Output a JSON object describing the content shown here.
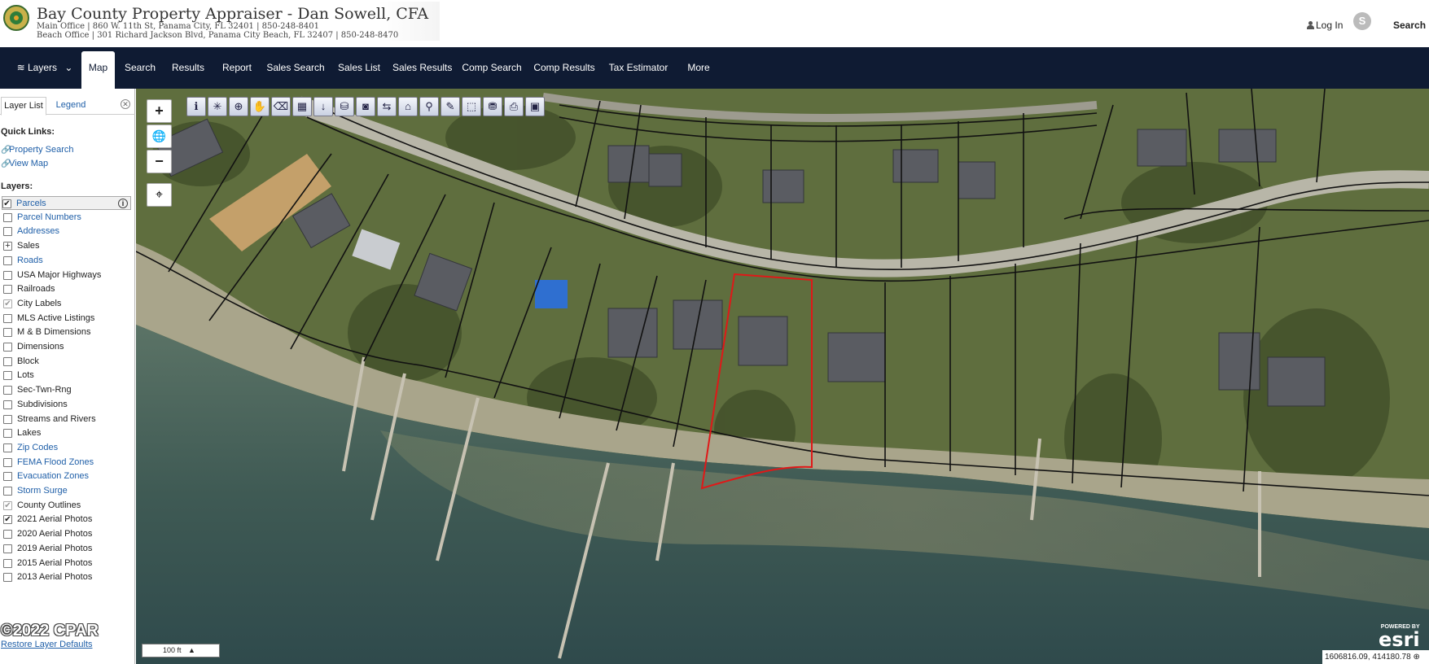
{
  "header": {
    "title": "Bay County Property Appraiser - Dan Sowell, CFA",
    "main_office": "Main Office | 860 W. 11th St, Panama City, FL 32401 | 850-248-8401",
    "beach_office": "Beach Office | 301 Richard Jackson Blvd, Panama City Beach, FL 32407 | 850-248-8470",
    "login_label": "Log In",
    "search_label": "Search"
  },
  "nav": {
    "layers_label": "Layers",
    "items": [
      "Map",
      "Search",
      "Results",
      "Report",
      "Sales Search",
      "Sales List",
      "Sales Results",
      "Comp Search",
      "Comp Results",
      "Tax Estimator",
      "More"
    ]
  },
  "sidebar": {
    "tab_layer_list": "Layer List",
    "tab_legend": "Legend",
    "quick_links_heading": "Quick Links:",
    "quick_links": [
      "Property Search",
      "View Map"
    ],
    "layers_heading": "Layers:",
    "layers": [
      {
        "label": "Parcels",
        "checked": true,
        "link": true
      },
      {
        "label": "Parcel Numbers",
        "checked": false,
        "link": true
      },
      {
        "label": "Addresses",
        "checked": false,
        "link": true
      },
      {
        "label": "Sales",
        "checked": false,
        "link": false,
        "expand": true
      },
      {
        "label": "Roads",
        "checked": false,
        "link": true
      },
      {
        "label": "USA Major Highways",
        "checked": false,
        "link": false
      },
      {
        "label": "Railroads",
        "checked": false,
        "link": false
      },
      {
        "label": "City Labels",
        "checked": true,
        "link": false,
        "gray": true
      },
      {
        "label": "MLS Active Listings",
        "checked": false,
        "link": false
      },
      {
        "label": "M & B Dimensions",
        "checked": false,
        "link": false
      },
      {
        "label": "Dimensions",
        "checked": false,
        "link": false
      },
      {
        "label": "Block",
        "checked": false,
        "link": false
      },
      {
        "label": "Lots",
        "checked": false,
        "link": false
      },
      {
        "label": "Sec-Twn-Rng",
        "checked": false,
        "link": false
      },
      {
        "label": "Subdivisions",
        "checked": false,
        "link": false
      },
      {
        "label": "Streams and Rivers",
        "checked": false,
        "link": false
      },
      {
        "label": "Lakes",
        "checked": false,
        "link": false
      },
      {
        "label": "Zip Codes",
        "checked": false,
        "link": true
      },
      {
        "label": "FEMA Flood Zones",
        "checked": false,
        "link": true
      },
      {
        "label": "Evacuation Zones",
        "checked": false,
        "link": true
      },
      {
        "label": "Storm Surge",
        "checked": false,
        "link": true
      },
      {
        "label": "County Outlines",
        "checked": true,
        "link": false,
        "gray": true
      },
      {
        "label": "2021 Aerial Photos",
        "checked": true,
        "link": false
      },
      {
        "label": "2020 Aerial Photos",
        "checked": false,
        "link": false
      },
      {
        "label": "2019 Aerial Photos",
        "checked": false,
        "link": false
      },
      {
        "label": "2015 Aerial Photos",
        "checked": false,
        "link": false
      },
      {
        "label": "2013 Aerial Photos",
        "checked": false,
        "link": false
      }
    ],
    "restore_label": "Restore Layer Defaults",
    "copyright": "©2022 CPAR"
  },
  "map": {
    "scale_label": "100 ft",
    "coordinates": "1606816.09, 414180.78",
    "esri_powered": "POWERED BY",
    "esri_brand": "esri",
    "zoom_in": "+",
    "zoom_out": "−",
    "tool_icons": [
      "identify-icon",
      "clear-icon",
      "zoom-to-icon",
      "pan-icon",
      "erase-icon",
      "select-icon",
      "pin-icon",
      "print-icon",
      "photo-icon",
      "buffer-icon",
      "buildings-icon",
      "magnify-icon",
      "draw-icon",
      "measure-icon",
      "layers-icon",
      "printer-icon",
      "save-icon"
    ],
    "colors": {
      "parcel_line": "#111111",
      "selected_parcel": "#e01818",
      "water": "#4f6a5a",
      "land": "#6b7a45"
    }
  }
}
